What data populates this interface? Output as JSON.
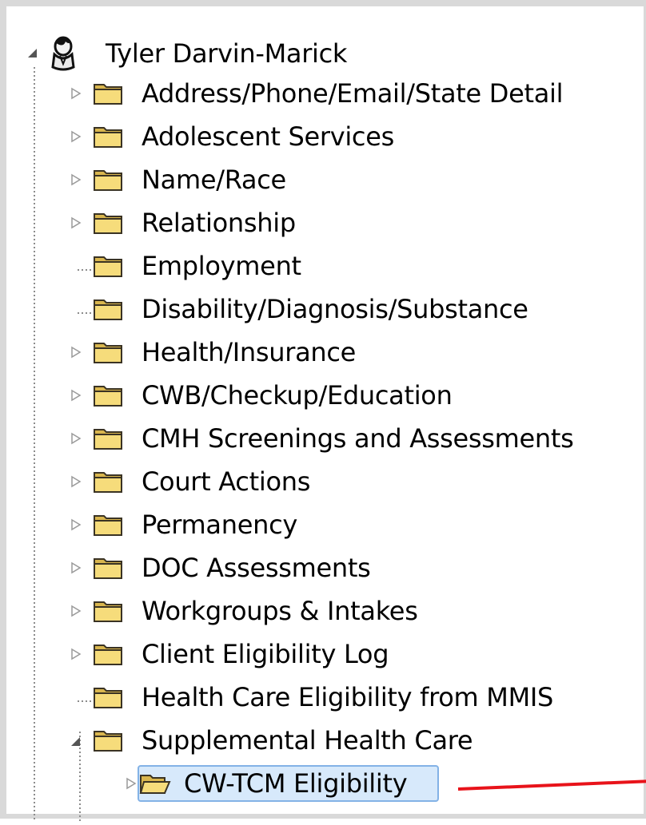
{
  "tree": {
    "root": {
      "label": "Tyler Darvin-Marick",
      "icon": "person-icon",
      "expanded": true
    },
    "children": [
      {
        "label": "Address/Phone/Email/State Detail",
        "has_children": true
      },
      {
        "label": "Adolescent Services",
        "has_children": true
      },
      {
        "label": "Name/Race",
        "has_children": true
      },
      {
        "label": "Relationship",
        "has_children": true
      },
      {
        "label": "Employment",
        "has_children": false
      },
      {
        "label": "Disability/Diagnosis/Substance",
        "has_children": false
      },
      {
        "label": "Health/Insurance",
        "has_children": true
      },
      {
        "label": "CWB/Checkup/Education",
        "has_children": true
      },
      {
        "label": "CMH Screenings and Assessments",
        "has_children": true
      },
      {
        "label": "Court Actions",
        "has_children": true
      },
      {
        "label": "Permanency",
        "has_children": true
      },
      {
        "label": "DOC Assessments",
        "has_children": true
      },
      {
        "label": "Workgroups & Intakes",
        "has_children": true
      },
      {
        "label": "Client Eligibility Log",
        "has_children": true
      },
      {
        "label": "Health Care Eligibility from MMIS",
        "has_children": false
      },
      {
        "label": "Supplemental Health Care",
        "has_children": true,
        "expanded": true
      }
    ],
    "selected_child": {
      "label": "CW-TCM Eligibility",
      "has_children": true,
      "selected": true,
      "icon": "open-folder-icon"
    }
  },
  "colors": {
    "annotation_arrow": "#e8131a",
    "selection_fill": "#d7e9fb",
    "selection_border": "#83b2e6",
    "folder_fill": "#f6dc7b",
    "folder_stroke": "#3a3324"
  }
}
